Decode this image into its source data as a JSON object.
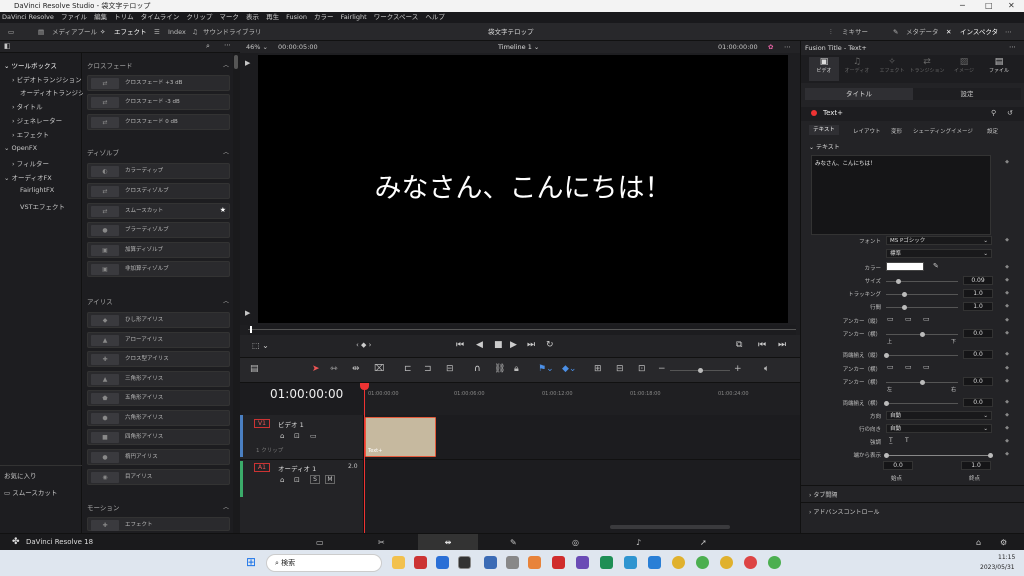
{
  "window": {
    "title": "DaVinci Resolve Studio - 袋文字テロップ"
  },
  "menu": [
    "DaVinci Resolve",
    "ファイル",
    "編集",
    "トリム",
    "タイムライン",
    "クリップ",
    "マーク",
    "表示",
    "再生",
    "Fusion",
    "カラー",
    "Fairlight",
    "ワークスペース",
    "ヘルプ"
  ],
  "toolbar": {
    "media_pool": "メディアプール",
    "effects": "エフェクト",
    "index": "Index",
    "sound_library": "サウンドライブラリ",
    "project": "袋文字テロップ",
    "mixer": "ミキサー",
    "metadata": "メタデータ",
    "inspector": "インスペクタ"
  },
  "library": {
    "toolbox": "ツールボックス",
    "items": [
      "ビデオトランジション",
      "オーディオトランジシ...",
      "タイトル",
      "ジェネレーター",
      "エフェクト"
    ],
    "openfx": "OpenFX",
    "filter": "フィルター",
    "audiofx": "オーディオFX",
    "fairlightfx": "FairlightFX",
    "vst": "VSTエフェクト",
    "favorites": "お気に入り",
    "favorite_item": "スムースカット"
  },
  "fx": {
    "crossfade_hdr": "クロスフェード",
    "crossfade": [
      "クロスフェード +3 dB",
      "クロスフェード -3 dB",
      "クロスフェード 0 dB"
    ],
    "dissolve_hdr": "ディゾルブ",
    "dissolve": [
      "カラーディップ",
      "クロスディゾルブ",
      "スムースカット",
      "ブラーディゾルブ",
      "加算ディゾルブ",
      "非加算ディゾルブ"
    ],
    "iris_hdr": "アイリス",
    "iris": [
      "ひし形アイリス",
      "アローアイリス",
      "クロス型アイリス",
      "三角形アイリス",
      "五角形アイリス",
      "六角形アイリス",
      "四角形アイリス",
      "楕円アイリス",
      "目アイリス"
    ],
    "motion_hdr": "モーション",
    "motion": [
      "エフェクト"
    ]
  },
  "viewer": {
    "zoom": "46%",
    "timecode": "00:00:05:00",
    "timeline_name": "Timeline 1",
    "tc_right": "01:00:00:00",
    "text": "みなさん、こんにちは！"
  },
  "timeline": {
    "timecode": "01:00:00:00",
    "ruler": [
      "01:00:00:00",
      "01:00:06:00",
      "01:00:12:00",
      "01:00:18:00",
      "01:00:24:00"
    ],
    "v1": "V1",
    "v1_name": "ビデオ 1",
    "v1_count": "1 クリップ",
    "a1": "A1",
    "a1_name": "オーディオ 1",
    "a1_ch": "2.0",
    "clip": "Text+",
    "s": "S",
    "m": "M"
  },
  "inspector": {
    "title": "Fusion Title - Text+",
    "tabs": [
      "ビデオ",
      "オーディオ",
      "エフェクト",
      "トランジション",
      "イメージ",
      "ファイル"
    ],
    "sub": [
      "タイトル",
      "設定"
    ],
    "node": "Text+",
    "node_tabs": [
      "テキスト",
      "レイアウト",
      "変形",
      "シェーディング",
      "イメージ",
      "設定"
    ],
    "section": "テキスト",
    "text_value": "みなさん、こんにちは！",
    "font_label": "フォント",
    "font": "MS Pゴシック",
    "style": "標準",
    "color_label": "カラー",
    "size_label": "サイズ",
    "size": "0.09",
    "tracking_label": "トラッキング",
    "tracking": "1.0",
    "line_label": "行間",
    "line": "1.0",
    "anchor_v_label": "アンカー（縦）",
    "anchor_h_label": "アンカー（横）",
    "anchor_h": "0.0",
    "top": "上",
    "bottom": "下",
    "justify_v_label": "両端揃え（縦）",
    "justify_v": "0.0",
    "anchor_h2_label": "アンカー（横）",
    "anchor_h3_label": "アンカー（横）",
    "anchor_h3": "0.0",
    "left": "左",
    "right": "右",
    "justify_h_label": "両端揃え（横）",
    "justify_h": "0.0",
    "direction_label": "方向",
    "direction": "自動",
    "line_dir_label": "行の向き",
    "line_dir": "自動",
    "emphasis_label": "強調",
    "write_label": "端から表示",
    "start": "0.0",
    "end": "1.0",
    "start_label": "始点",
    "end_label": "終点",
    "tab_spacing": "タブ間隔",
    "advanced": "アドバンスコントロール"
  },
  "pagebar": {
    "app": "DaVinci Resolve 18"
  },
  "taskbar": {
    "search": "検索",
    "time": "11:15",
    "date": "2023/05/31"
  },
  "colors": {
    "accent": "#e35a3a",
    "clip": "#c6b99f",
    "playhead": "#e33333"
  }
}
